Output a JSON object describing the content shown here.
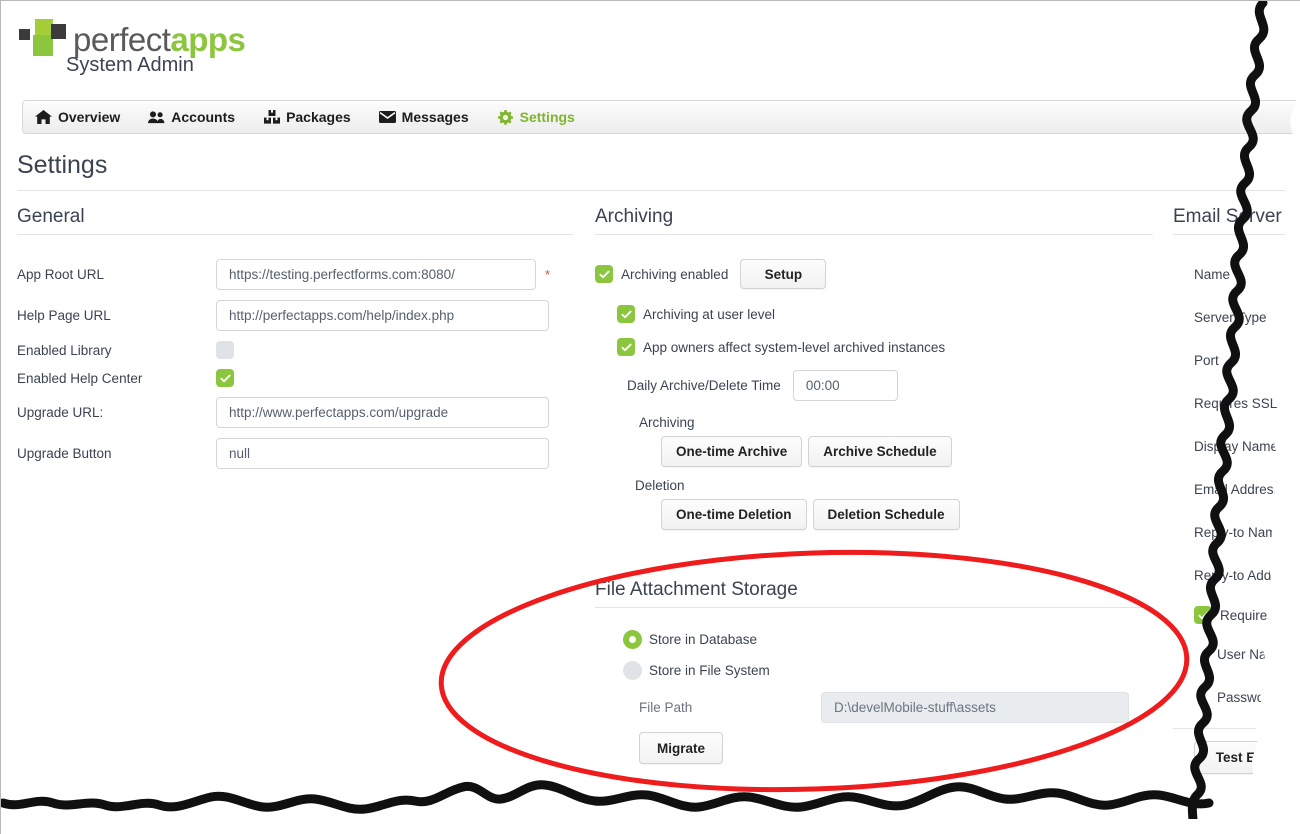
{
  "brand": {
    "logo_perfect": "perfect",
    "logo_apps": "apps",
    "subtitle": "System Admin"
  },
  "nav": {
    "items": [
      {
        "label": "Overview",
        "icon": "home-icon",
        "active": false
      },
      {
        "label": "Accounts",
        "icon": "users-icon",
        "active": false
      },
      {
        "label": "Packages",
        "icon": "packages-icon",
        "active": false
      },
      {
        "label": "Messages",
        "icon": "envelope-icon",
        "active": false
      },
      {
        "label": "Settings",
        "icon": "gear-icon",
        "active": true
      }
    ]
  },
  "page": {
    "title": "Settings"
  },
  "general": {
    "section_title": "General",
    "app_root_url_label": "App Root URL",
    "app_root_url_value": "https://testing.perfectforms.com:8080/",
    "required_marker": "*",
    "help_page_url_label": "Help Page URL",
    "help_page_url_value": "http://perfectapps.com/help/index.php",
    "enabled_library_label": "Enabled Library",
    "enabled_library_checked": false,
    "enabled_help_center_label": "Enabled Help Center",
    "enabled_help_center_checked": true,
    "upgrade_url_label": "Upgrade URL:",
    "upgrade_url_value": "http://www.perfectapps.com/upgrade",
    "upgrade_button_label": "Upgrade Button",
    "upgrade_button_value": "null"
  },
  "archiving": {
    "section_title": "Archiving",
    "archiving_enabled_label": "Archiving enabled",
    "archiving_enabled_checked": true,
    "setup_button": "Setup",
    "user_level_label": "Archiving at user level",
    "user_level_checked": true,
    "app_owners_label": "App owners affect system-level archived instances",
    "app_owners_checked": true,
    "daily_time_label": "Daily Archive/Delete Time",
    "daily_time_value": "00:00",
    "archiving_group_label": "Archiving",
    "one_time_archive_button": "One-time Archive",
    "archive_schedule_button": "Archive Schedule",
    "deletion_group_label": "Deletion",
    "one_time_deletion_button": "One-time Deletion",
    "deletion_schedule_button": "Deletion Schedule"
  },
  "file_storage": {
    "section_title": "File Attachment Storage",
    "store_in_database_label": "Store in Database",
    "store_in_database_selected": true,
    "store_in_file_system_label": "Store in File System",
    "store_in_file_system_selected": false,
    "file_path_label": "File Path",
    "file_path_value": "D:\\develMobile-stuff\\assets",
    "migrate_button": "Migrate"
  },
  "email_server": {
    "section_title": "Email Server",
    "fields": [
      {
        "label": "Name"
      },
      {
        "label": "Server Type"
      },
      {
        "label": "Port"
      },
      {
        "label": "Requires SSL"
      },
      {
        "label": "Display Name"
      },
      {
        "label": "Email Address"
      },
      {
        "label": "Reply-to Name"
      },
      {
        "label": "Reply-to Address"
      }
    ],
    "requires_auth_label": "Requires",
    "requires_auth_checked": true,
    "user_name_label": "User Name",
    "password_label": "Password",
    "test_email_button": "Test Email"
  },
  "annotation": {
    "type": "ellipse-highlight",
    "color": "#ee1c1c",
    "targets": "File Attachment Storage"
  }
}
